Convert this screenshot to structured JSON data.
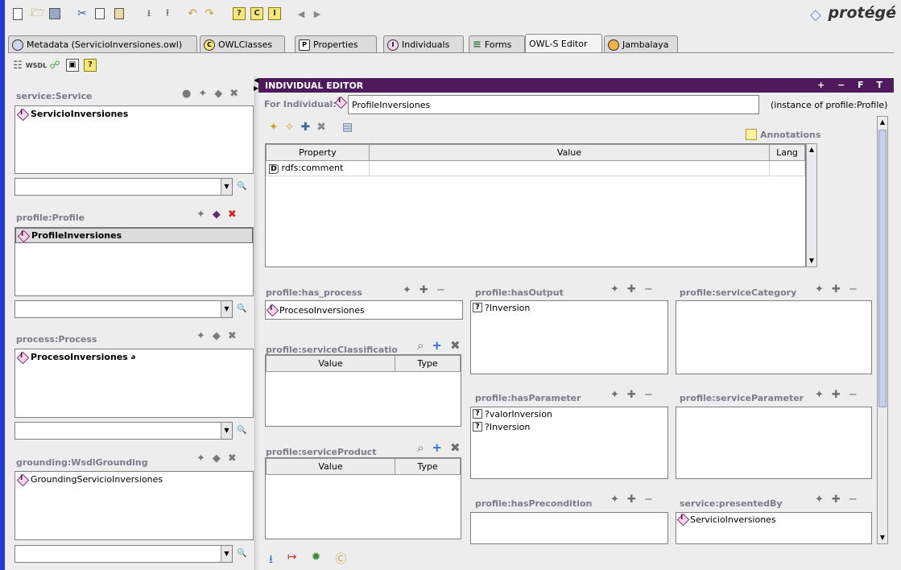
{
  "app": {
    "logo": "protégé"
  },
  "tabs": [
    {
      "label": "Metadata (ServicioInversiones.owl)",
      "icon": "metadata-icon"
    },
    {
      "label": "OWLClasses",
      "icon": "classes-icon"
    },
    {
      "label": "Properties",
      "icon": "properties-icon"
    },
    {
      "label": "Individuals",
      "icon": "individuals-icon"
    },
    {
      "label": "Forms",
      "icon": "forms-icon"
    },
    {
      "label": "OWL-S Editor",
      "icon": "",
      "active": true
    },
    {
      "label": "Jambalaya",
      "icon": "jambalaya-icon"
    }
  ],
  "left": {
    "service": {
      "title": "service:Service",
      "items": [
        "ServicioInversiones"
      ]
    },
    "profile": {
      "title": "profile:Profile",
      "items": [
        "ProfileInversiones"
      ]
    },
    "process": {
      "title": "process:Process",
      "items": [
        "ProcesoInversiones"
      ],
      "suffix": "a"
    },
    "grounding": {
      "title": "grounding:WsdlGrounding",
      "items": [
        "GroundingServicioInversiones"
      ]
    }
  },
  "editor": {
    "title": "INDIVIDUAL EDITOR",
    "controls": "+ − F T",
    "for_label": "For Individual:",
    "individual": "ProfileInversiones",
    "instance_of": "(instance of profile:Profile)",
    "annotations_label": "Annotations",
    "table": {
      "headers": [
        "Property",
        "Value",
        "Lang"
      ],
      "rows": [
        {
          "property": "rdfs:comment",
          "value": "",
          "lang": ""
        }
      ]
    },
    "has_process": {
      "title": "profile:has_process",
      "items": [
        "ProcesoInversiones"
      ]
    },
    "service_classification": {
      "title": "profile:serviceClassificatio",
      "headers": [
        "Value",
        "Type"
      ]
    },
    "service_product": {
      "title": "profile:serviceProduct",
      "headers": [
        "Value",
        "Type"
      ]
    },
    "has_output": {
      "title": "profile:hasOutput",
      "items": [
        "?Inversion"
      ]
    },
    "has_parameter": {
      "title": "profile:hasParameter",
      "items": [
        "?valorInversion",
        "?Inversion"
      ]
    },
    "has_precondition": {
      "title": "profile:hasPrecondition",
      "items": []
    },
    "service_category": {
      "title": "profile:serviceCategory",
      "items": []
    },
    "service_parameter": {
      "title": "profile:serviceParameter",
      "items": []
    },
    "presented_by": {
      "title": "service:presentedBy",
      "items": [
        "ServicioInversiones"
      ]
    }
  }
}
